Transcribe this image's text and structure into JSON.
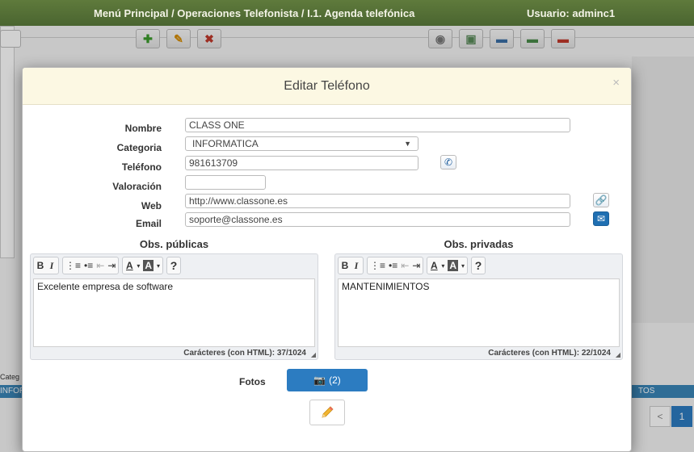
{
  "topbar": {
    "breadcrumb": "Menú Principal /  Operaciones Telefonista / I.1. Agenda telefónica",
    "user": "Usuario: adminc1"
  },
  "background": {
    "categ_label": "Categ",
    "strip_left": "INFOR",
    "strip_right": "TOS",
    "pager_prev": "<",
    "pager_current": "1"
  },
  "modal": {
    "title": "Editar Teléfono",
    "close": "×",
    "fields": {
      "nombre": {
        "label": "Nombre",
        "value": "CLASS ONE"
      },
      "categoria": {
        "label": "Categoria",
        "value": "INFORMATICA"
      },
      "telefono": {
        "label": "Teléfono",
        "value": "981613709"
      },
      "valoracion": {
        "label": "Valoración",
        "value": ""
      },
      "web": {
        "label": "Web",
        "value": "http://www.classone.es"
      },
      "email": {
        "label": "Email",
        "value": "soporte@classone.es"
      }
    },
    "obs_publicas": {
      "title": "Obs. públicas",
      "content": "Excelente empresa de software",
      "count": "Carácteres (con HTML): 37/1024"
    },
    "obs_privadas": {
      "title": "Obs. privadas",
      "content": "MANTENIMIENTOS",
      "count": "Carácteres (con HTML): 22/1024"
    },
    "fotos": {
      "label": "Fotos",
      "count": "(2)"
    }
  },
  "colors": {
    "topbar": "#4a6530",
    "modal_header": "#fcf8e3",
    "primary_button": "#2c7cc1",
    "strip": "#3a85b8"
  }
}
